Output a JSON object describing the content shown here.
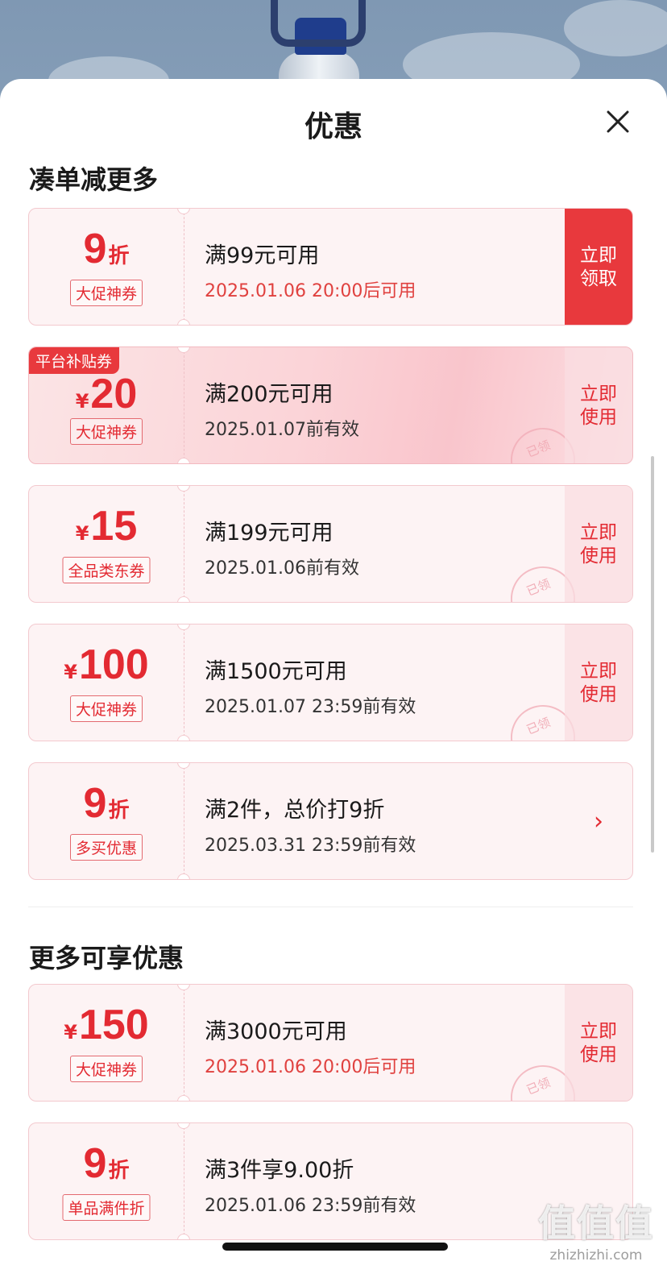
{
  "sheet": {
    "title": "优惠",
    "close_icon": "close-icon"
  },
  "sections": [
    {
      "heading": "凑单减更多",
      "coupons": [
        {
          "type": "discount",
          "amount": "9",
          "unit": "折",
          "tag": "大促神券",
          "condition": "满99元可用",
          "date": "2025.01.06 20:00后可用",
          "date_red": true,
          "action": "立即领取",
          "action_style": "solid"
        },
        {
          "type": "money",
          "currency": "¥",
          "amount": "20",
          "tag": "大促神券",
          "badge": "平台补贴券",
          "condition": "满200元可用",
          "date": "2025.01.07前有效",
          "action": "立即使用",
          "stamp": "已领"
        },
        {
          "type": "money",
          "currency": "¥",
          "amount": "15",
          "tag": "全品类东券",
          "condition": "满199元可用",
          "date": "2025.01.06前有效",
          "action": "立即使用",
          "stamp": "已领"
        },
        {
          "type": "money",
          "currency": "¥",
          "amount": "100",
          "tag": "大促神券",
          "condition": "满1500元可用",
          "date": "2025.01.07 23:59前有效",
          "action": "立即使用",
          "stamp": "已领"
        },
        {
          "type": "discount",
          "amount": "9",
          "unit": "折",
          "tag": "多买优惠",
          "condition": "满2件，总价打9折",
          "date": "2025.03.31 23:59前有效",
          "action": "›",
          "action_style": "chevron"
        }
      ]
    },
    {
      "heading": "更多可享优惠",
      "coupons": [
        {
          "type": "money",
          "currency": "¥",
          "amount": "150",
          "tag": "大促神券",
          "condition": "满3000元可用",
          "date": "2025.01.06 20:00后可用",
          "date_red": true,
          "action": "立即使用",
          "stamp": "已领"
        },
        {
          "type": "discount",
          "amount": "9",
          "unit": "折",
          "tag": "单品满件折",
          "condition": "满3件享9.00折",
          "date": "2025.01.06 23:59前有效"
        }
      ]
    }
  ],
  "watermark": {
    "logo": "值值值",
    "text": "zhizhizhi.com"
  },
  "colors": {
    "accent": "#e32a32",
    "action_bg": "#e8393d",
    "coupon_bg": "#fdf3f4"
  }
}
